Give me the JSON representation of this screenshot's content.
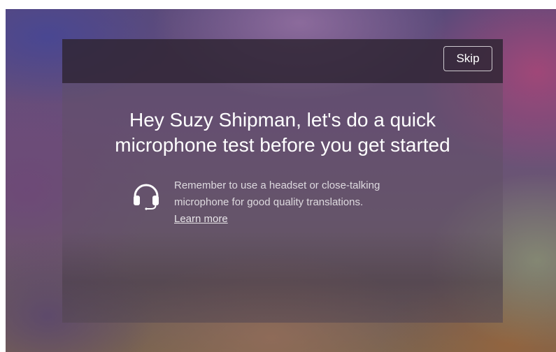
{
  "dialog": {
    "skip_label": "Skip",
    "title_line1": "Hey Suzy Shipman, let's do a quick",
    "title_line2": "microphone test before you get started",
    "tip": {
      "icon": "headset-icon",
      "line1": "Remember to use a headset or close-talking",
      "line2": "microphone for good quality translations.",
      "link_label": "Learn more"
    }
  }
}
